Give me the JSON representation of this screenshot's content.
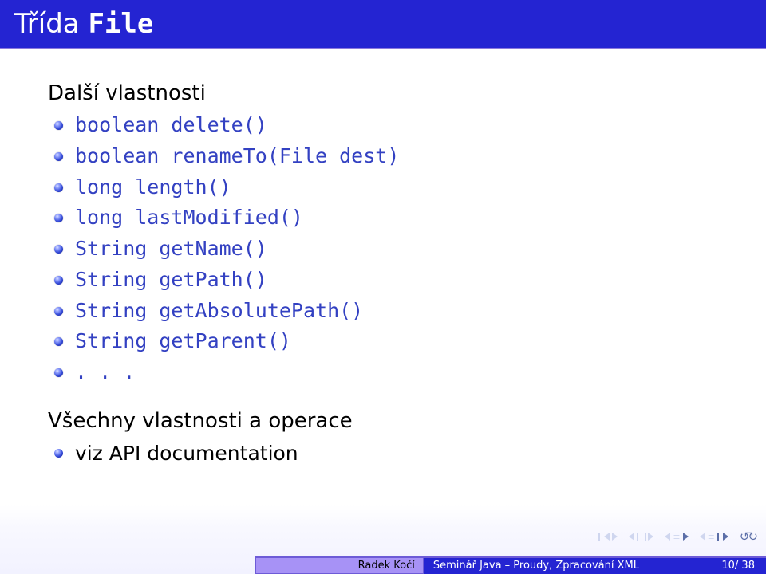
{
  "title": {
    "prefix": "Třída",
    "code": "File"
  },
  "section1": {
    "heading": "Další vlastnosti",
    "items": [
      "boolean delete()",
      "boolean renameTo(File dest)",
      "long length()",
      "long lastModified()",
      "String getName()",
      "String getPath()",
      "String getAbsolutePath()",
      "String getParent()",
      ". . ."
    ]
  },
  "section2": {
    "heading": "Všechny vlastnosti a operace",
    "items": [
      "viz API documentation"
    ]
  },
  "footer": {
    "author": "Radek Kočí",
    "subject": "Seminář Java – Proudy, Zpracování XML",
    "page": "10/ 38"
  }
}
